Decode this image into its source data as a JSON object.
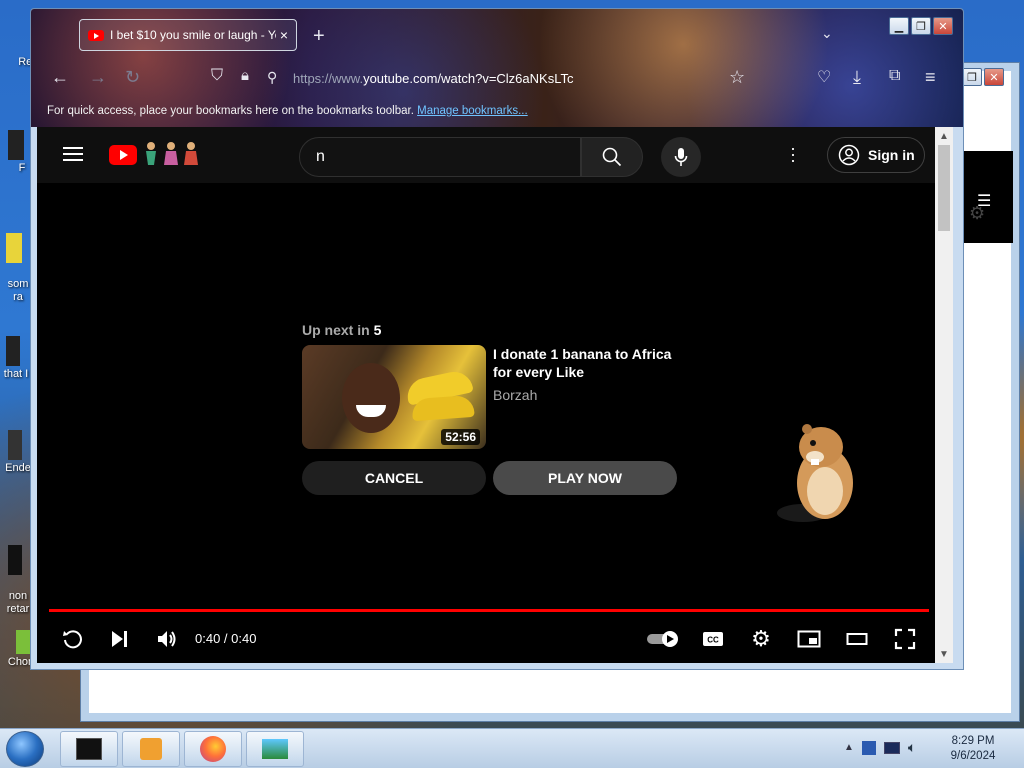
{
  "desktop": {
    "icons": [
      {
        "label": "Rec"
      },
      {
        "label": "F"
      },
      {
        "label": "som\nra"
      },
      {
        "label": "that I"
      },
      {
        "label": "Ende"
      },
      {
        "label": "non\nretar"
      },
      {
        "label": "ChomikBox"
      }
    ]
  },
  "browser": {
    "tab_title": "I bet $10 you smile or laugh - Yo",
    "url_dim": "https://www.",
    "url_main": "youtube.com/watch?v=Clz6aNKsLTc",
    "bookmarks_text": "For quick access, place your bookmarks here on the bookmarks toolbar.",
    "bookmarks_link": "Manage bookmarks..."
  },
  "youtube": {
    "search_value": "n",
    "signin_label": "Sign in",
    "up_next_prefix": "Up next in",
    "up_next_count": "5",
    "next_video": {
      "title": "I donate 1 banana to Africa for every Like",
      "channel": "Borzah",
      "duration": "52:56"
    },
    "cancel_label": "CANCEL",
    "play_now_label": "PLAY NOW",
    "time_display": "0:40 / 0:40",
    "progress": 1.0,
    "accent_color": "#ff0000"
  },
  "taskbar": {
    "clock_time": "8:29 PM",
    "clock_date": "9/6/2024"
  }
}
